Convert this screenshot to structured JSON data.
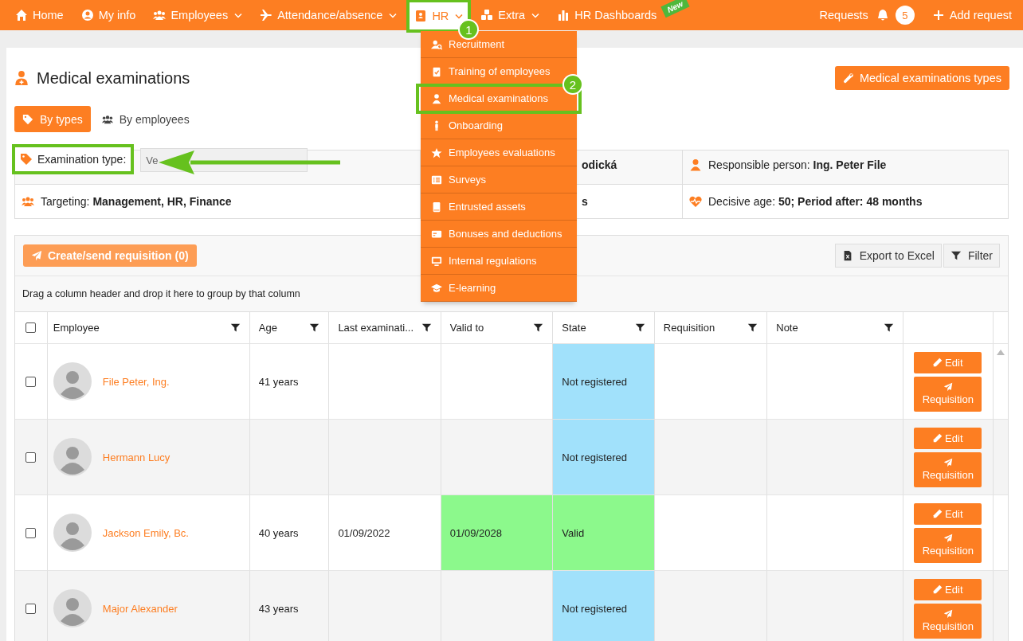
{
  "nav": {
    "items": [
      {
        "label": "Home",
        "dropdown": false,
        "selected": false
      },
      {
        "label": "My info",
        "dropdown": false,
        "selected": false
      },
      {
        "label": "Employees",
        "dropdown": true,
        "selected": false
      },
      {
        "label": "Attendance/absence",
        "dropdown": true,
        "selected": false
      },
      {
        "label": "HR",
        "dropdown": true,
        "selected": true
      },
      {
        "label": "Extra",
        "dropdown": true,
        "selected": false
      },
      {
        "label": "HR Dashboards",
        "dropdown": false,
        "selected": false,
        "badge": "New"
      }
    ],
    "requests": "Requests",
    "requests_count": "5",
    "add_request": "Add request"
  },
  "menu": [
    {
      "label": "Recruitment",
      "selected": false
    },
    {
      "label": "Training of employees",
      "selected": false
    },
    {
      "label": "Medical examinations",
      "selected": true
    },
    {
      "label": "Onboarding",
      "selected": false
    },
    {
      "label": "Employees evaluations",
      "selected": false
    },
    {
      "label": "Surveys",
      "selected": false
    },
    {
      "label": "Entrusted assets",
      "selected": false
    },
    {
      "label": "Bonuses and deductions",
      "selected": false
    },
    {
      "label": "Internal regulations",
      "selected": false
    },
    {
      "label": "E-learning",
      "selected": false
    }
  ],
  "callouts": [
    "1",
    "2"
  ],
  "page": {
    "title": "Medical examinations",
    "types_button": "Medical examinations types",
    "view_tabs": [
      {
        "label": "By types",
        "selected": true
      },
      {
        "label": "By employees",
        "selected": false
      }
    ]
  },
  "info": {
    "exam_label": "Examination type:",
    "exam_value": "Ve",
    "mid_top": "odická",
    "resp_label": "Responsible person:",
    "resp_value": "Ing. Peter File",
    "target_label": "Targeting:",
    "target_value": "Management, HR, Finance",
    "mid_bottom": "s",
    "age_label": "Decisive age:",
    "age_value": "50; Period after: 48 months"
  },
  "toolbar": {
    "requisition_button": "Create/send requisition (0)",
    "export": "Export to Excel",
    "filter": "Filter"
  },
  "group_hint": "Drag a column header and drop it here to group by that column",
  "table": {
    "header_checked": false,
    "columns": [
      "Employee",
      "Age",
      "Last examinati...",
      "Valid to",
      "State",
      "Requisition",
      "Note"
    ],
    "rows": [
      {
        "checked": false,
        "employee": "File Peter, Ing.",
        "age": "41 years",
        "last": "",
        "valid_to": "",
        "state": "Not registered",
        "color": "#a1e1fb",
        "edit": "Edit",
        "requisition": "Requisition"
      },
      {
        "checked": false,
        "employee": "Hermann Lucy",
        "age": "",
        "last": "",
        "valid_to": "",
        "state": "Not registered",
        "color": "#a1e1fb",
        "edit": "Edit",
        "requisition": "Requisition"
      },
      {
        "checked": false,
        "employee": "Jackson Emily, Bc.",
        "age": "40 years",
        "last": "01/09/2022",
        "valid_to": "01/09/2028",
        "state": "Valid",
        "color": "#8cf98c",
        "edit": "Edit",
        "requisition": "Requisition"
      },
      {
        "checked": false,
        "employee": "Major Alexander",
        "age": "43 years",
        "last": "",
        "valid_to": "",
        "state": "Not registered",
        "color": "#a1e1fb",
        "edit": "Edit",
        "requisition": "Requisition"
      }
    ]
  }
}
